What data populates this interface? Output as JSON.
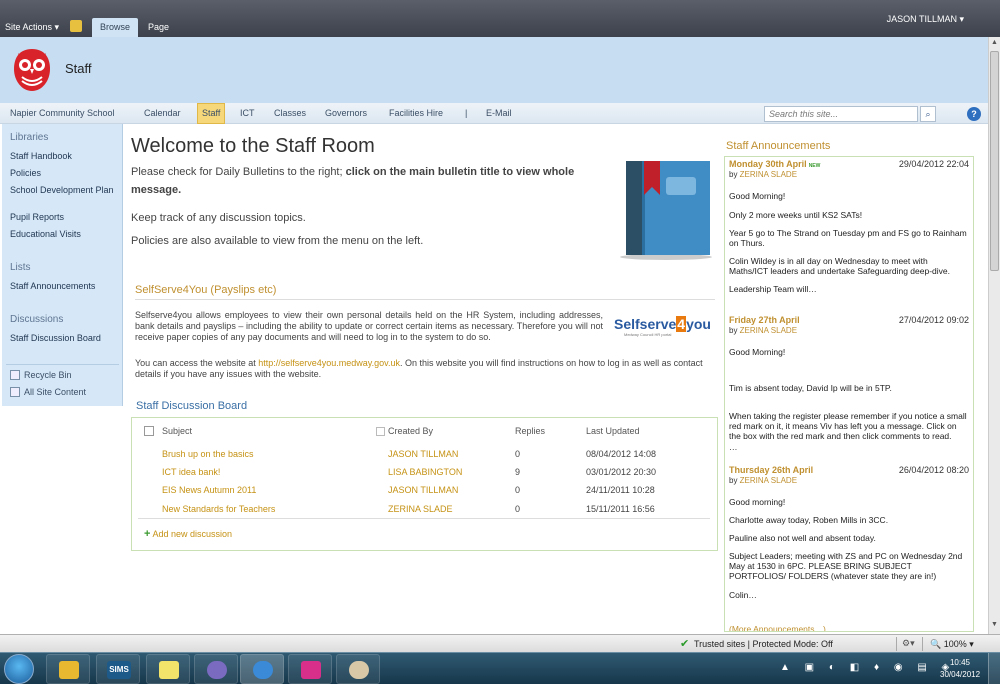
{
  "topbar": {
    "site_actions": "Site Actions ▾",
    "tabs": [
      "Browse",
      "Page"
    ],
    "user": "JASON TILLMAN ▾"
  },
  "site": {
    "title": "Staff"
  },
  "nav": {
    "items": [
      "Napier Community School",
      "Calendar",
      "Staff",
      "ICT",
      "Classes",
      "Governors",
      "Facilities Hire",
      "|",
      "E-Mail"
    ],
    "active": "Staff",
    "search_placeholder": "Search this site..."
  },
  "quicklaunch": {
    "libraries_heading": "Libraries",
    "libraries": [
      "Staff Handbook",
      "Policies",
      "School Development Plan",
      "Pupil Reports",
      "Educational Visits"
    ],
    "lists_heading": "Lists",
    "lists": [
      "Staff Announcements"
    ],
    "discussions_heading": "Discussions",
    "discussions": [
      "Staff Discussion Board"
    ],
    "recycle_bin": "Recycle Bin",
    "all_site_content": "All Site Content"
  },
  "main": {
    "title": "Welcome to the Staff Room",
    "line1_plain": "Please check for Daily Bulletins to the right; ",
    "line1_bold": "click on the main bulletin title to view whole message.",
    "line2": "Keep track of any discussion topics.",
    "line3": "Policies are also available to view from the menu on the left."
  },
  "selfserve": {
    "title": "SelfServe4You (Payslips etc)",
    "para1": "Selfserve4you allows employees to view their own personal details held on the HR System, including addresses, bank details and payslips – including the ability to update or correct certain items as necessary. Therefore you will not receive paper copies of any pay documents and will need to log in to the system to do so.",
    "para2_pre": "You can access the website at ",
    "para2_link": "http://selfserve4you.medway.gov.uk",
    "para2_post": ". On this website you will find instructions on how to log in as well as contact details if you have any issues with the website.",
    "logo_text_a": "Selfserve",
    "logo_text_b": "4",
    "logo_text_c": "you",
    "logo_tagline": "Medway Council HR portal"
  },
  "board": {
    "title": "Staff Discussion Board",
    "headers": [
      "Subject",
      "Created By",
      "Replies",
      "Last Updated"
    ],
    "rows": [
      {
        "subject": "Brush up on the basics",
        "created_by": "JASON TILLMAN",
        "replies": "0",
        "updated": "08/04/2012 14:08"
      },
      {
        "subject": "ICT idea bank!",
        "created_by": "LISA BABINGTON",
        "replies": "9",
        "updated": "03/01/2012 20:30"
      },
      {
        "subject": "EIS News Autumn 2011",
        "created_by": "JASON TILLMAN",
        "replies": "0",
        "updated": "24/11/2011 10:28"
      },
      {
        "subject": "New Standards for Teachers",
        "created_by": "ZERINA SLADE",
        "replies": "0",
        "updated": "15/11/2011 16:56"
      }
    ],
    "add_label": "Add new discussion"
  },
  "announcements": {
    "title": "Staff Announcements",
    "items": [
      {
        "heading": "Monday 30th April",
        "badge": "NEW",
        "date": "29/04/2012 22:04",
        "by_prefix": "by ",
        "author": "ZERINA SLADE",
        "paras": [
          "Good Morning!",
          "Only 2 more weeks until KS2 SATs!",
          "Year 5 go to The Strand on Tuesday pm and FS go to Rainham on Thurs.",
          "Colin Wildey is in all day on Wednesday to meet with Maths/ICT leaders and undertake Safeguarding deep-dive.",
          "Leadership Team will…"
        ]
      },
      {
        "heading": "Friday 27th April",
        "date": "27/04/2012 09:02",
        "by_prefix": "by ",
        "author": "ZERINA SLADE",
        "paras": [
          "Good Morning!",
          "Tim is absent today, David Ip will be in 5TP.",
          "When taking the register please remember if you notice a small red mark on it, it means Viv has left you a message.  Click on the box with the red mark and then click comments to read.",
          "…"
        ]
      },
      {
        "heading": "Thursday 26th April",
        "date": "26/04/2012 08:20",
        "by_prefix": "by ",
        "author": "ZERINA SLADE",
        "paras": [
          "Good morning!",
          "Charlotte away today, Roben Mills in 3CC.",
          "Pauline also not well and absent today.",
          "Subject Leaders; meeting with ZS and PC on Wednesday 2nd May at 1530 in 6PC. PLEASE BRING SUBJECT PORTFOLIOS/ FOLDERS (whatever state they are in!)",
          "Colin…"
        ]
      }
    ],
    "more": "(More Announcements…)"
  },
  "statusbar": {
    "trusted": "Trusted sites | Protected Mode: Off",
    "zoom": "100%"
  },
  "taskbar": {
    "sims": "SIMS",
    "time": "10:45",
    "date": "30/04/2012"
  },
  "colors": {
    "accent_gold": "#c09030",
    "nav_active": "#f6d77a",
    "title_bar": "#c6ddf2",
    "quicklaunch": "#d6e8f8"
  }
}
